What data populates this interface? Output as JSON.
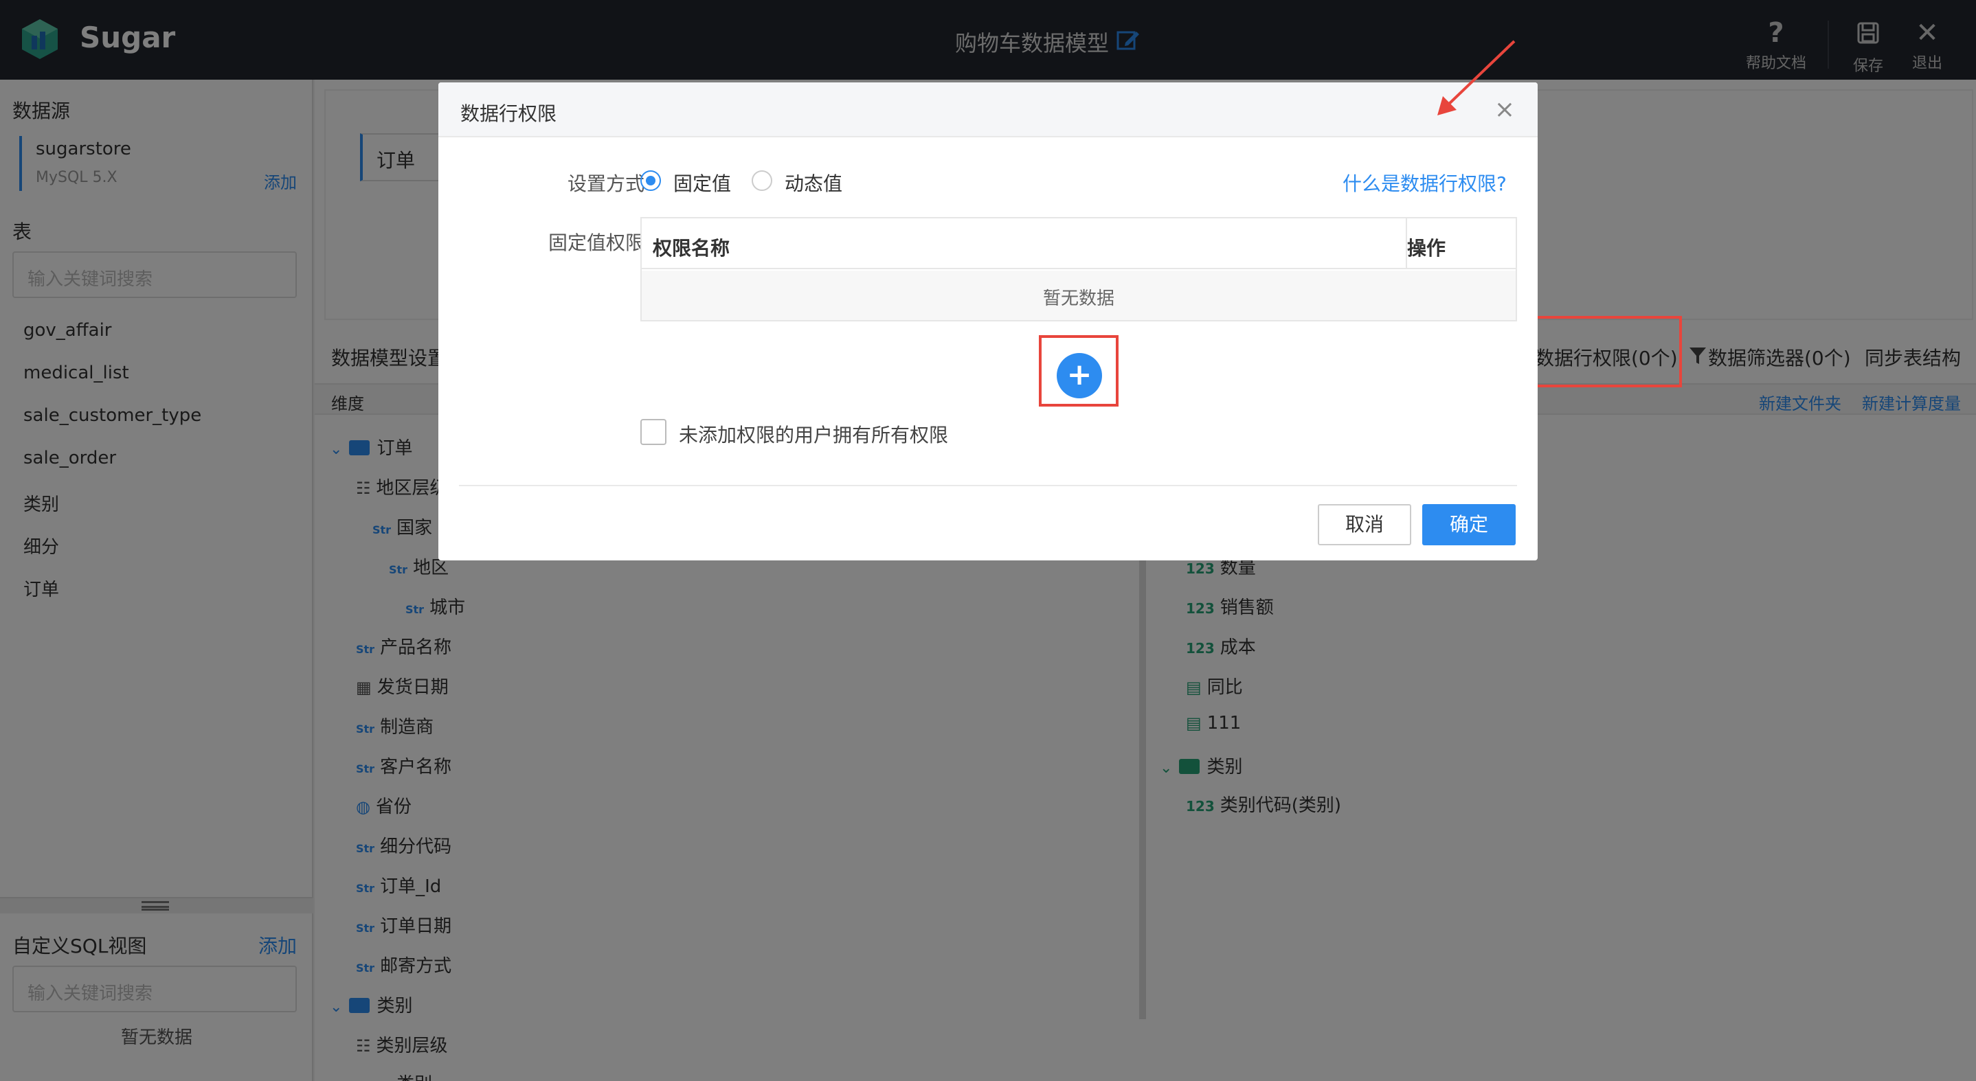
{
  "app": {
    "name": "Sugar",
    "model_title": "购物车数据模型"
  },
  "topbar": {
    "help": "帮助文档",
    "save": "保存",
    "exit": "退出"
  },
  "sidebar": {
    "datasource_heading": "数据源",
    "datasource": {
      "name": "sugarstore",
      "version": "MySQL 5.X",
      "add": "添加"
    },
    "table_heading": "表",
    "table_search_placeholder": "输入关键词搜索",
    "tables": [
      "gov_affair",
      "medical_list",
      "sale_customer_type",
      "sale_order",
      "类别",
      "细分",
      "订单"
    ],
    "sql_heading": "自定义SQL视图",
    "sql_add": "添加",
    "sql_search_placeholder": "输入关键词搜索",
    "sql_empty": "暂无数据"
  },
  "canvas": {
    "tab": "订单"
  },
  "model_toolbar": {
    "title": "数据模型设置",
    "row_permission": "数据行权限(0个)",
    "filter": "数据筛选器(0个)",
    "sync": "同步表结构"
  },
  "subheader": {
    "dimension": "维度",
    "new_folder": "新建文件夹",
    "new_measure": "新建计算度量"
  },
  "dimensions": {
    "folder_order": "订单",
    "region_level": "地区层级",
    "country": "国家",
    "region": "地区",
    "city": "城市",
    "product_name": "产品名称",
    "ship_date": "发货日期",
    "maker": "制造商",
    "customer_name": "客户名称",
    "province": "省份",
    "segment_code": "细分代码",
    "order_id": "订单_Id",
    "order_date": "订单日期",
    "ship_mode": "邮寄方式",
    "folder_category": "类别",
    "category_level": "类别层级",
    "category": "类别"
  },
  "measures": {
    "quantity": "数量",
    "sales": "销售额",
    "cost": "成本",
    "yoy": "同比",
    "m111": "111",
    "folder_category": "类别",
    "category_code": "类别代码(类别)"
  },
  "tags": {
    "str": "Str",
    "num": "123"
  },
  "dialog": {
    "title": "数据行权限",
    "mode_label": "设置方式",
    "mode_fixed": "固定值",
    "mode_dynamic": "动态值",
    "help_link": "什么是数据行权限?",
    "fixed_label": "固定值权限",
    "col_name": "权限名称",
    "col_op": "操作",
    "empty": "暂无数据",
    "add_symbol": "+",
    "checkbox_label": "未添加权限的用户拥有所有权限",
    "cancel": "取消",
    "ok": "确定",
    "close_symbol": "×"
  },
  "colors": {
    "accent": "#2d8cf0",
    "highlight": "#e8453c",
    "topbar": "#23262e"
  },
  "icons": [
    "logo-icon",
    "edit-icon",
    "help-icon",
    "save-icon",
    "close-icon",
    "filter-icon",
    "folder-icon",
    "chevron-down-icon",
    "add-icon",
    "arrow-annotation"
  ]
}
